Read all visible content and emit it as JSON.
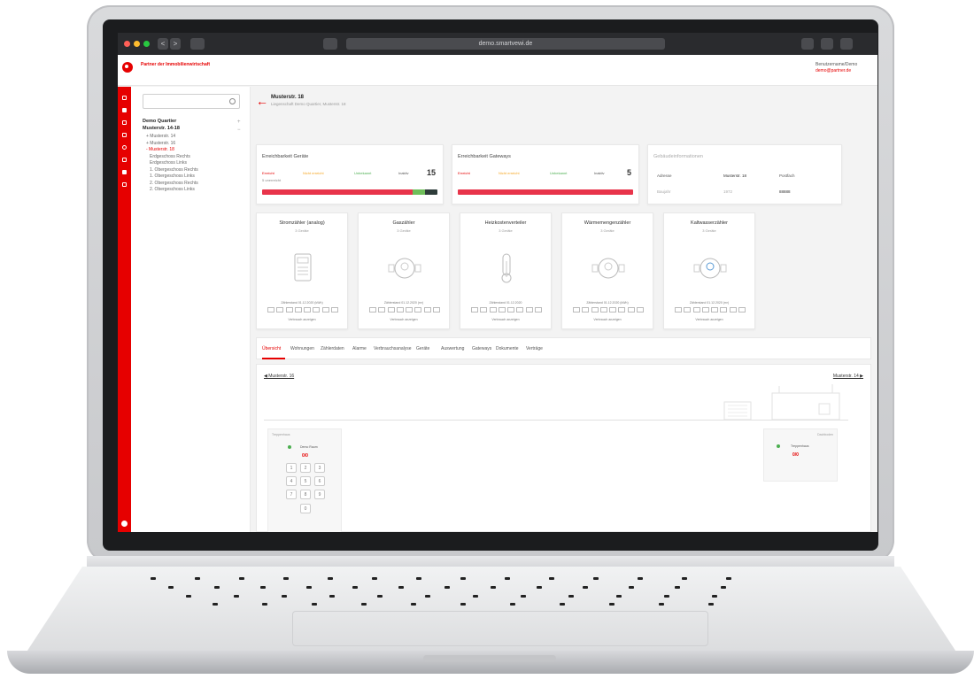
{
  "browser": {
    "url": "demo.smartvewi.de",
    "back": "<",
    "forward": ">"
  },
  "header": {
    "brand": "Partner der Immobilienwirtschaft",
    "user_name": "Benutzername/Demo",
    "user_email": "demo@partner.de"
  },
  "tree": {
    "items": [
      {
        "label": "Demo Quartier",
        "style": "bold"
      },
      {
        "label": "Musterstr. 14-18",
        "style": "bold"
      },
      {
        "label": "+ Musterstr. 14",
        "style": "normal"
      },
      {
        "label": "+ Musterstr. 16",
        "style": "normal"
      },
      {
        "label": "- Musterstr. 18",
        "style": "active"
      },
      {
        "label": "Erdgeschoss Rechts",
        "style": "normal"
      },
      {
        "label": "Erdgeschoss Links",
        "style": "normal"
      },
      {
        "label": "1. Obergeschoss Rechts",
        "style": "normal"
      },
      {
        "label": "1. Obergeschoss Links",
        "style": "normal"
      },
      {
        "label": "2. Obergeschoss Rechts",
        "style": "normal"
      },
      {
        "label": "2. Obergeschoss Links",
        "style": "normal"
      }
    ]
  },
  "page": {
    "title": "Musterstr. 18",
    "subtitle": "Liegenschaft Demo Quartier, Musterstr. 18"
  },
  "cards": {
    "devices": {
      "title": "Erreichbarkeit Geräte",
      "legend": [
        {
          "label": "Erreicht",
          "color": "#e60000"
        },
        {
          "label": "Nicht erreicht",
          "color": "#f5a623"
        },
        {
          "label": "Unbekannt",
          "color": "#4caf50"
        },
        {
          "label": "Inaktiv",
          "color": "#555555"
        }
      ],
      "sub": "5 unerreicht",
      "total": "15",
      "segments": [
        {
          "fraction": 0.86,
          "color": "#e8344a"
        },
        {
          "fraction": 0.07,
          "color": "#6fbf5a"
        },
        {
          "fraction": 0.07,
          "color": "#2e3c3a"
        }
      ]
    },
    "gateways": {
      "title": "Erreichbarkeit Gateways",
      "legend": [
        {
          "label": "Erreicht",
          "color": "#e60000"
        },
        {
          "label": "Nicht erreicht",
          "color": "#f5a623"
        },
        {
          "label": "Unbekannt",
          "color": "#4caf50"
        },
        {
          "label": "Inaktiv",
          "color": "#555555"
        }
      ],
      "total": "5",
      "segments": [
        {
          "fraction": 1.0,
          "color": "#e8344a"
        }
      ]
    },
    "info": {
      "title": "Gebäudeinformationen",
      "labels": [
        "Adresse",
        "Baujahr"
      ],
      "values": [
        "Musterstr. 18",
        "1972"
      ],
      "extra_label": "Postfach",
      "extra_value": "88888"
    }
  },
  "meters": [
    {
      "title": "Stromzähler (analog)",
      "sub": "3 Geräte",
      "reading": "Zählerstand 01.12.2020 (kWh)",
      "link": "Verbrauch anzeigen",
      "icon": "electricity-meter-icon"
    },
    {
      "title": "Gaszähler",
      "sub": "3 Geräte",
      "reading": "Zählerstand 01.12.2020 (m³)",
      "link": "Verbrauch anzeigen",
      "icon": "gas-meter-icon"
    },
    {
      "title": "Heizkostenverteiler",
      "sub": "3 Geräte",
      "reading": "Zählerstand 01.12.2020",
      "link": "Verbrauch anzeigen",
      "icon": "thermometer-icon"
    },
    {
      "title": "Wärmemengenzähler",
      "sub": "3 Geräte",
      "reading": "Zählerstand 01.12.2020 (kWh)",
      "link": "Verbrauch anzeigen",
      "icon": "heat-meter-icon"
    },
    {
      "title": "Kaltwasserzähler",
      "sub": "3 Geräte",
      "reading": "Zählerstand 01.12.2020 (m³)",
      "link": "Verbrauch anzeigen",
      "icon": "water-meter-icon"
    }
  ],
  "tabs": [
    "Übersicht",
    "Wohnungen",
    "Zählerdaten",
    "Alarme",
    "Verbrauchsanalyse",
    "Geräte",
    "Auswertung",
    "Gateways",
    "Dokumente",
    "Verträge"
  ],
  "building": {
    "prev": "◀ Musterstr. 16",
    "next": "Musterstr. 14 ▶",
    "left_box_label": "Treppenhaus",
    "left_unit": "Demo Raum",
    "left_value": "0/0",
    "right_box_label": "Dachboden",
    "right_unit": "Treppenhaus",
    "right_value": "0/0",
    "keypad": [
      "1",
      "2",
      "3",
      "4",
      "5",
      "6",
      "7",
      "8",
      "9",
      "0"
    ]
  },
  "colors": {
    "accent": "#e60000"
  }
}
